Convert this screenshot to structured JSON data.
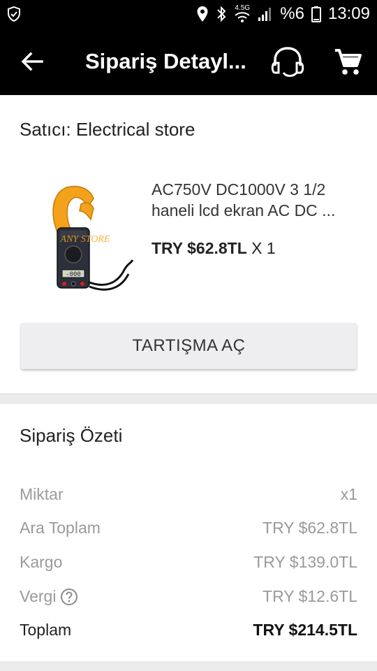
{
  "status_bar": {
    "network": "4.5G",
    "battery": "%6",
    "time": "13:09"
  },
  "app_bar": {
    "title": "Sipariş Detayl...",
    "icons": [
      "back-arrow-icon",
      "headset-support-icon",
      "shopping-cart-icon"
    ]
  },
  "order": {
    "seller_label": "Satıcı: Electrical store",
    "product": {
      "title_line1": "AC750V DC1000V 3 1/2",
      "title_line2": "haneli lcd ekran AC DC ...",
      "price": "TRY $62.8TL",
      "quantity": "X 1",
      "image_watermark": "ANY STORE"
    },
    "dispute_button": "TARTIŞMA AÇ"
  },
  "summary": {
    "title": "Sipariş Özeti",
    "rows": [
      {
        "label": "Miktar",
        "value": "x1"
      },
      {
        "label": "Ara Toplam",
        "value": "TRY $62.8TL"
      },
      {
        "label": "Kargo",
        "value": "TRY $139.0TL"
      },
      {
        "label": "Vergi",
        "value": "TRY $12.6TL"
      },
      {
        "label": "Toplam",
        "value": "TRY $214.5TL"
      }
    ]
  },
  "colors": {
    "bar": "#000000",
    "muted_text": "#9a9a9a",
    "button_bg": "#eeeef0"
  }
}
